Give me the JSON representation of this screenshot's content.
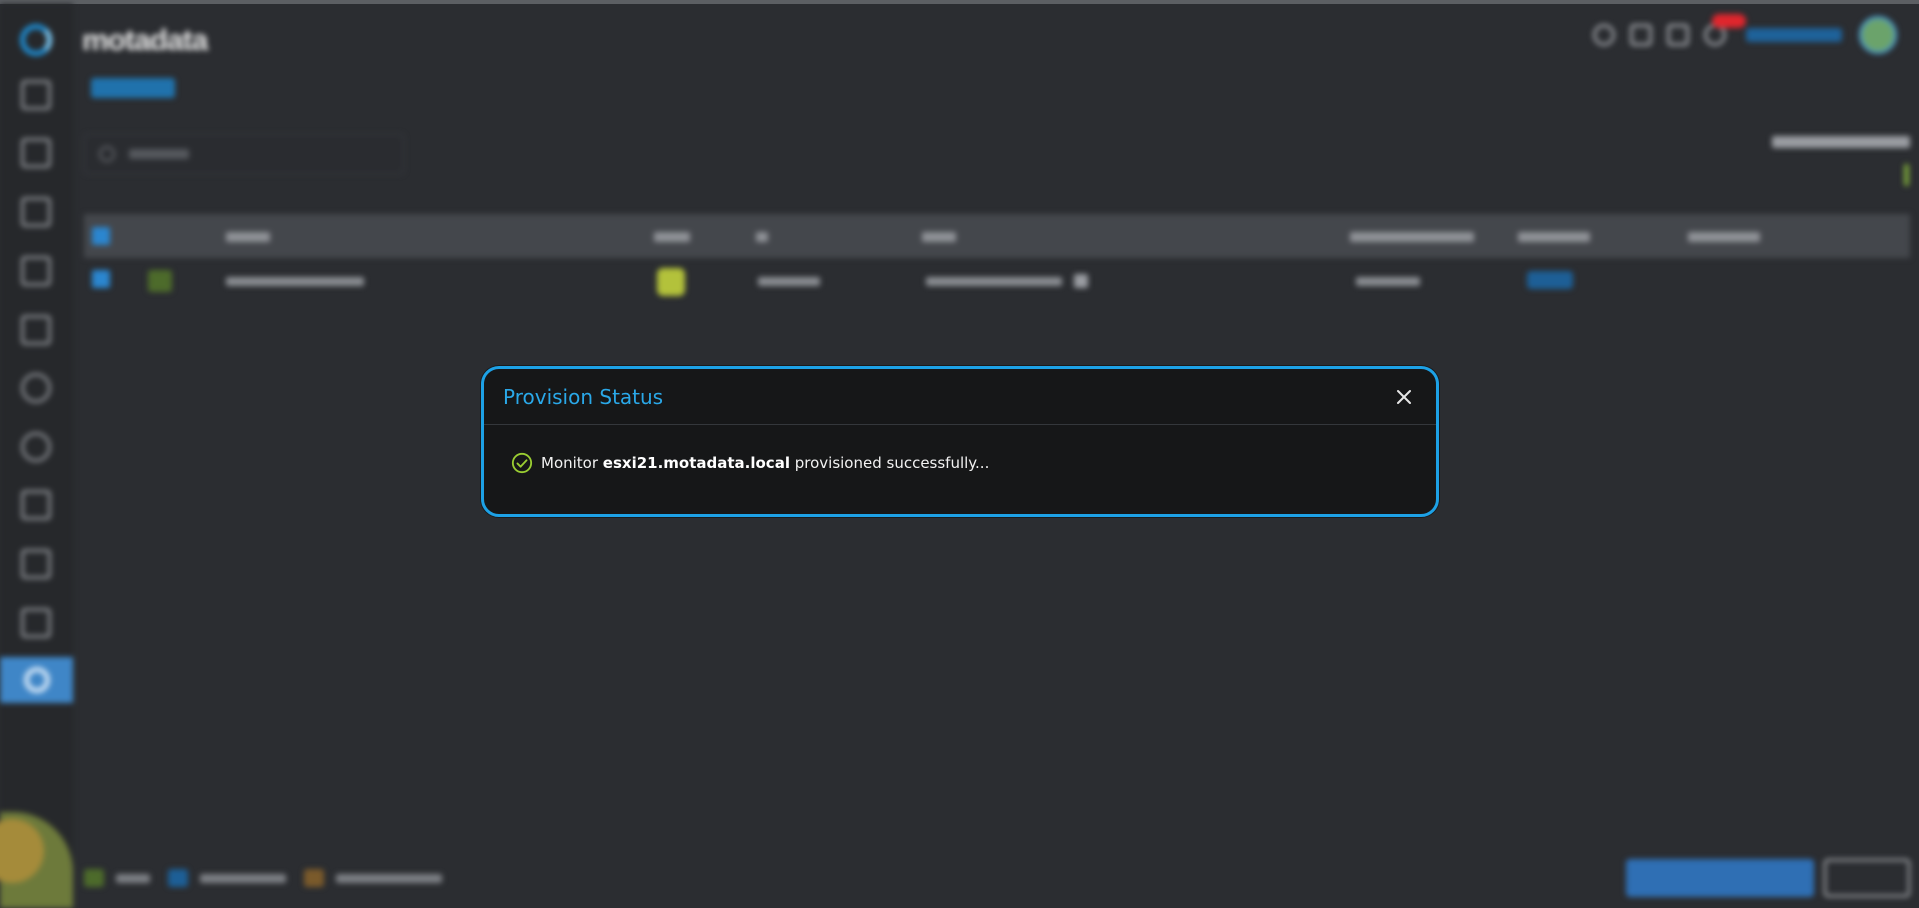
{
  "modal": {
    "title": "Provision Status",
    "message_prefix": "Monitor ",
    "message_host": "esxi21.motadata.local",
    "message_suffix": " provisioned successfully...",
    "status_icon": "check-circle-icon",
    "close_icon": "close-icon",
    "accent_color": "#1da1e6",
    "success_color": "#9acd32"
  },
  "background": {
    "brand_text": "motadata",
    "blurred": true
  }
}
